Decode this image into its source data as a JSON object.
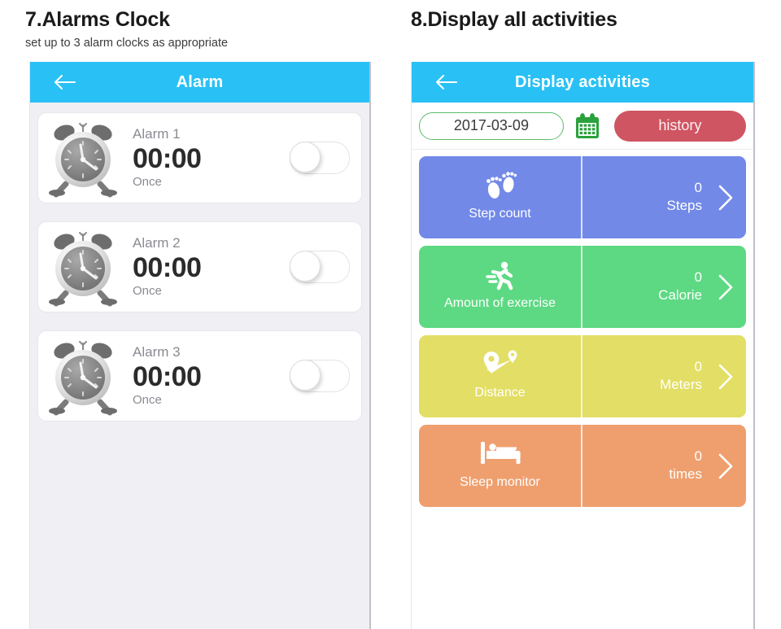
{
  "left_section": {
    "title": "7.Alarms Clock",
    "subtitle": "set up to 3 alarm clocks as appropriate",
    "screen": {
      "appbar": {
        "title": "Alarm",
        "back_icon": "back-arrow-icon"
      },
      "alarms": [
        {
          "name": "Alarm 1",
          "time": "00:00",
          "repeat": "Once",
          "toggle_state": "off",
          "icon": "alarm-clock-icon"
        },
        {
          "name": "Alarm 2",
          "time": "00:00",
          "repeat": "Once",
          "toggle_state": "off",
          "icon": "alarm-clock-icon"
        },
        {
          "name": "Alarm 3",
          "time": "00:00",
          "repeat": "Once",
          "toggle_state": "off",
          "icon": "alarm-clock-icon"
        }
      ]
    }
  },
  "right_section": {
    "title": "8.Display all activities",
    "screen": {
      "appbar": {
        "title": "Display activities",
        "back_icon": "back-arrow-icon"
      },
      "toolbar": {
        "date_value": "2017-03-09",
        "calendar_icon": "calendar-icon",
        "history_label": "history"
      },
      "activities": [
        {
          "label": "Step count",
          "value": "0",
          "unit": "Steps",
          "color": "#7289e8",
          "icon": "footprints-icon"
        },
        {
          "label": "Amount of exercise",
          "value": "0",
          "unit": "Calorie",
          "color": "#5dd983",
          "icon": "running-person-icon"
        },
        {
          "label": "Distance",
          "value": "0",
          "unit": "Meters",
          "color": "#e3de65",
          "icon": "route-pins-icon"
        },
        {
          "label": "Sleep monitor",
          "value": "0",
          "unit": "times",
          "color": "#ef9f6e",
          "icon": "bed-icon"
        }
      ]
    }
  },
  "colors": {
    "appbar_blue": "#29c1f5",
    "screen_bg": "#efeff4",
    "history_red": "#cf5563",
    "date_border_green": "#5bbd6a",
    "calendar_green": "#2aa13c"
  }
}
